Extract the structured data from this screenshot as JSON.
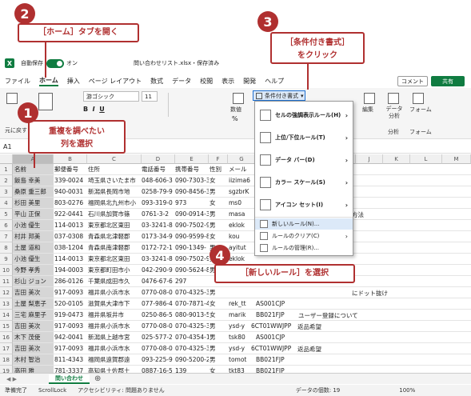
{
  "callouts": {
    "step2": {
      "num": "2",
      "text": "［ホーム］タブを開く"
    },
    "step3": {
      "num": "3",
      "text1": "［条件付き書式］",
      "text2": "をクリック"
    },
    "step1": {
      "num": "1",
      "text1": "重複を調べたい",
      "text2": "列を選択"
    },
    "step4": {
      "num": "4",
      "text": "［新しいルール］を選択"
    }
  },
  "titlebar": {
    "autosave": "自動保存",
    "toggle": "オン",
    "filename": "問い合わせリスト.xlsx・保存済み"
  },
  "menu": [
    "ファイル",
    "ホーム",
    "挿入",
    "ページ レイアウト",
    "数式",
    "データ",
    "校閲",
    "表示",
    "開発",
    "ヘルプ"
  ],
  "menu_active_index": 1,
  "comment_button": "コメント",
  "share_button": "共有",
  "ribbon": {
    "font_name": "游ゴシック",
    "font_size": "11",
    "number_label": "数値",
    "percent": "%",
    "cond_format": "条件付き書式",
    "edit_label": "編集",
    "data_analysis": "データ分析",
    "form_label": "フォーム",
    "form_label2": "フォーム",
    "analysis_label": "分析",
    "undo_label": "元に戻す"
  },
  "formula_bar": {
    "cell": "A1"
  },
  "columns": [
    "A",
    "B",
    "C",
    "D",
    "E",
    "F",
    "G",
    "H",
    "I",
    "J",
    "K",
    "L",
    "M"
  ],
  "rows": [
    {
      "n": "1",
      "a": "名前",
      "b": "郵便番号",
      "c": "住所",
      "d": "電話番号",
      "e": "携帯番号",
      "f": "性別",
      "g": "メール"
    },
    {
      "n": "2",
      "a": "飯島 幸美",
      "b": "339-0024",
      "c": "埼玉県さいたま市",
      "d": "048-606-3",
      "e": "090-7303-3",
      "f": "女",
      "g": "iizima6"
    },
    {
      "n": "3",
      "a": "桑原 重三郎",
      "b": "940-0031",
      "c": "新潟県長岡市地",
      "d": "0258-79-9",
      "e": "090-8456-3",
      "f": "男",
      "g": "sgzbrK"
    },
    {
      "n": "4",
      "a": "杉田 美里",
      "b": "803-0276",
      "c": "福岡県北九州市小",
      "d": "093-319-0",
      "e": "973",
      "f": "女",
      "g": "ms0"
    },
    {
      "n": "5",
      "a": "平山 正保",
      "b": "922-0441",
      "c": "石川県加賀市篠",
      "d": "0761-3-2",
      "e": "090-0914-3",
      "f": "男",
      "g": "masa"
    },
    {
      "n": "6",
      "a": "小池 優生",
      "b": "114-0013",
      "c": "東京都北区東田",
      "d": "03-3241-8",
      "e": "090-7502-9",
      "f": "男",
      "g": "eklok"
    },
    {
      "n": "7",
      "a": "村井 邦美",
      "b": "037-0308",
      "c": "青森県北津軽郡",
      "d": "0173-34-9",
      "e": "090-9599-8",
      "f": "女",
      "g": "kou"
    },
    {
      "n": "8",
      "a": "土屋 道和",
      "b": "038-1204",
      "c": "青森県南津軽郡",
      "d": "0172-72-1",
      "e": "090-1349-",
      "f": "男",
      "g": "ayitut"
    },
    {
      "n": "9",
      "a": "小池 優生",
      "b": "114-0013",
      "c": "東京都北区東田",
      "d": "03-3241-8",
      "e": "090-7502-9",
      "f": "男",
      "g": "eklok"
    },
    {
      "n": "10",
      "a": "今野 孝秀",
      "b": "194-0003",
      "c": "東京都町田市小",
      "d": "042-290-9",
      "e": "090-5624-8",
      "f": "男",
      "g": ""
    },
    {
      "n": "11",
      "a": "杉山 ジョン",
      "b": "286-0126",
      "c": "千葉県成田市久",
      "d": "0476-67-6",
      "e": "297",
      "f": "",
      "g": ""
    },
    {
      "n": "12",
      "a": "吉田 美次",
      "b": "917-0093",
      "b2": "",
      "c": "福井県小浜市水",
      "d": "0770-08-0",
      "e": "070-4325-3",
      "f": "男",
      "g": ""
    },
    {
      "n": "13",
      "a": "土屋 梨恵子",
      "b": "520-0105",
      "c": "滋賀県大津市下",
      "d": "077-986-4",
      "e": "070-7871-4",
      "f": "女",
      "g": "rek_tt"
    },
    {
      "n": "14",
      "a": "三宅 麻里子",
      "b": "919-0473",
      "c": "福井県坂井市",
      "d": "0250-86-5",
      "e": "080-9013-5",
      "f": "女",
      "g": "marik"
    },
    {
      "n": "15",
      "a": "吉田 美次",
      "b": "917-0093",
      "c": "福井県小浜市水",
      "d": "0770-08-0",
      "e": "070-4325-3",
      "f": "男",
      "g": "ysd-y"
    },
    {
      "n": "16",
      "a": "木下 茂使",
      "b": "942-0041",
      "c": "新潟県上越市宮",
      "d": "025-577-2",
      "e": "070-4354-1",
      "f": "男",
      "g": "tsk80"
    },
    {
      "n": "17",
      "a": "吉田 美次",
      "b": "917-0093",
      "c": "福井県小浜市水",
      "d": "0770-08-0",
      "e": "070-4325-3",
      "f": "男",
      "g": "ysd-y"
    },
    {
      "n": "18",
      "a": "木村 智治",
      "b": "811-4343",
      "c": "福岡県遠賀郡遠",
      "d": "093-225-9",
      "e": "090-5200-2",
      "f": "男",
      "g": "tomot"
    },
    {
      "n": "19",
      "a": "高田 雅",
      "b": "781-3337",
      "c": "高知県土佐郡土",
      "d": "0887-16-5",
      "e": "139",
      "f": "女",
      "g": "tkt83"
    }
  ],
  "extra_cells": {
    "r5": "方法",
    "r12": "にドット抜け",
    "r13": "AS001CJP",
    "r14a": "BB021FJP",
    "r14b": "ユーザー登録について",
    "r15a": "6CT01WWJPP",
    "r15b": "返品希望",
    "r16": "AS001CJP",
    "r17a": "6CT01WWJPP",
    "r17b": "返品希望",
    "r18": "BB021FJP",
    "r19": "BB021FJP"
  },
  "dropdown": {
    "items": [
      {
        "label": "セルの強調表示ルール(H)"
      },
      {
        "label": "上位/下位ルール(T)"
      },
      {
        "label": "データ バー(D)"
      },
      {
        "label": "カラー スケール(S)"
      },
      {
        "label": "アイコン セット(I)"
      }
    ],
    "small": [
      {
        "label": "新しいルール(N)..."
      },
      {
        "label": "ルールのクリア(C)"
      },
      {
        "label": "ルールの管理(R)..."
      }
    ]
  },
  "sheet_tab": "問い合わせ",
  "status": {
    "ready": "準備完了",
    "scroll": "ScrollLock",
    "access": "アクセシビリティ: 問題ありません",
    "count": "データの個数: 19",
    "zoom": "100%"
  }
}
